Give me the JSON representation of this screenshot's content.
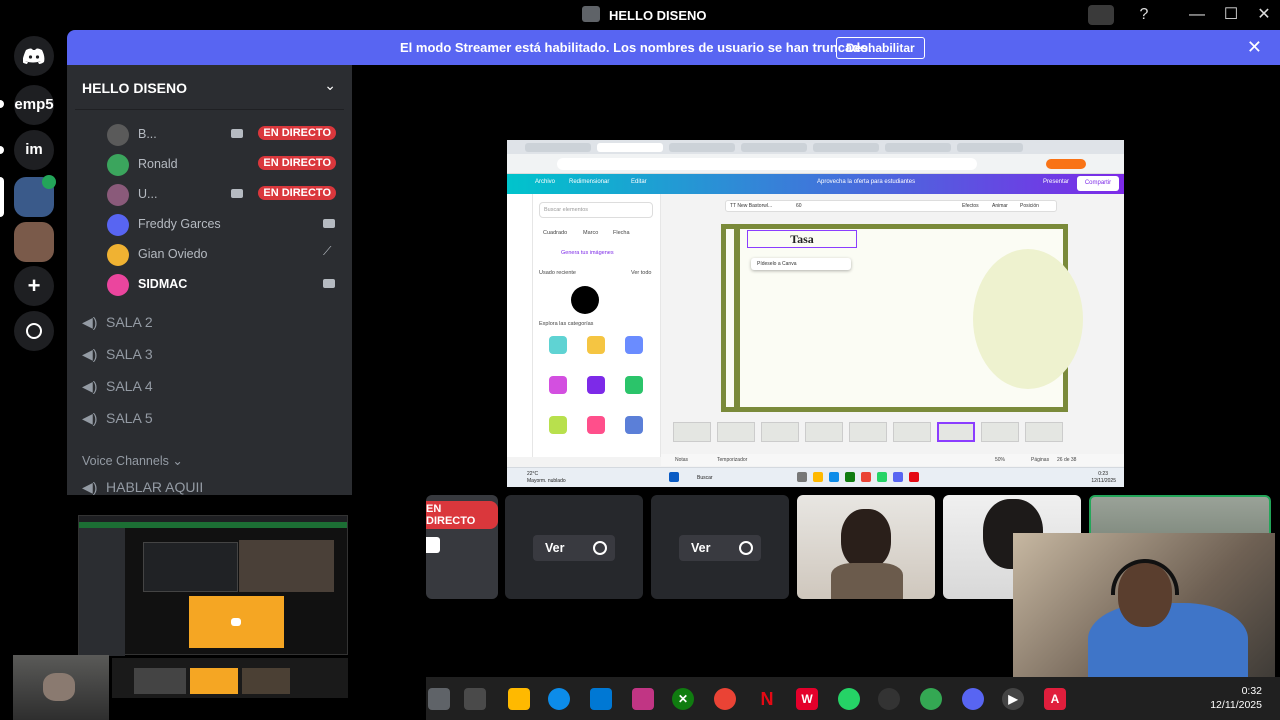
{
  "window": {
    "title": "HELLO DISENO",
    "controls": [
      "—",
      "☐",
      "✕"
    ]
  },
  "banner": {
    "message": "El modo Streamer está habilitado. Los nombres de usuario se han truncado.",
    "button": "Deshabilitar",
    "close": "✕"
  },
  "servers": [
    {
      "label": "emp5"
    },
    {
      "label": "im"
    }
  ],
  "sidebar": {
    "guild_name": "HELLO DISENO",
    "users": [
      {
        "name": "B...",
        "status": "EN DIRECTO"
      },
      {
        "name": "Ronald",
        "status": "EN DIRECTO"
      },
      {
        "name": "U...",
        "status": "EN DIRECTO"
      },
      {
        "name": "Freddy Garces"
      },
      {
        "name": "Gian Oviedo"
      },
      {
        "name": "SIDMAC"
      }
    ],
    "channels": [
      "SALA 2",
      "SALA 3",
      "SALA 4",
      "SALA 5"
    ],
    "category": "Voice Channels",
    "category_channel": "HABLAR AQUII"
  },
  "screenshare": {
    "heading_text": "Tasa",
    "float_btn": "Pídeselo a Canva",
    "search_placeholder": "Buscar elementos",
    "filters": [
      "Cuadrado",
      "Marco",
      "Flecha"
    ],
    "generate": "Genera tus imágenes",
    "recent_label": "Usado reciente",
    "see_all": "Ver todo",
    "categories_label": "Explora las categorías",
    "canva_bar": {
      "archivo": "Archivo",
      "redimensionar": "Redimensionar",
      "editar": "Editar",
      "offer": "Aprovecha la oferta para estudiantes",
      "present": "Presentar",
      "share": "Compartir"
    },
    "toolbar": {
      "font": "TT New Bastorwl...",
      "size": "60",
      "efectos": "Efectos",
      "animar": "Animar",
      "posicion": "Posición"
    },
    "footer": {
      "notes": "Notas",
      "timer": "Temporizador",
      "zoom": "50%",
      "pages": "Páginas",
      "page_count": "26 de 38"
    },
    "taskbar": {
      "weather": "22°C",
      "weather_desc": "Mayorm. nublado",
      "search": "Buscar",
      "time": "0:23",
      "date": "12/11/2025"
    }
  },
  "rail": {
    "live_tag": "EN DIRECTO",
    "view_label": "Ver"
  },
  "taskbar": {
    "time": "0:32",
    "date": "12/11/2025"
  }
}
